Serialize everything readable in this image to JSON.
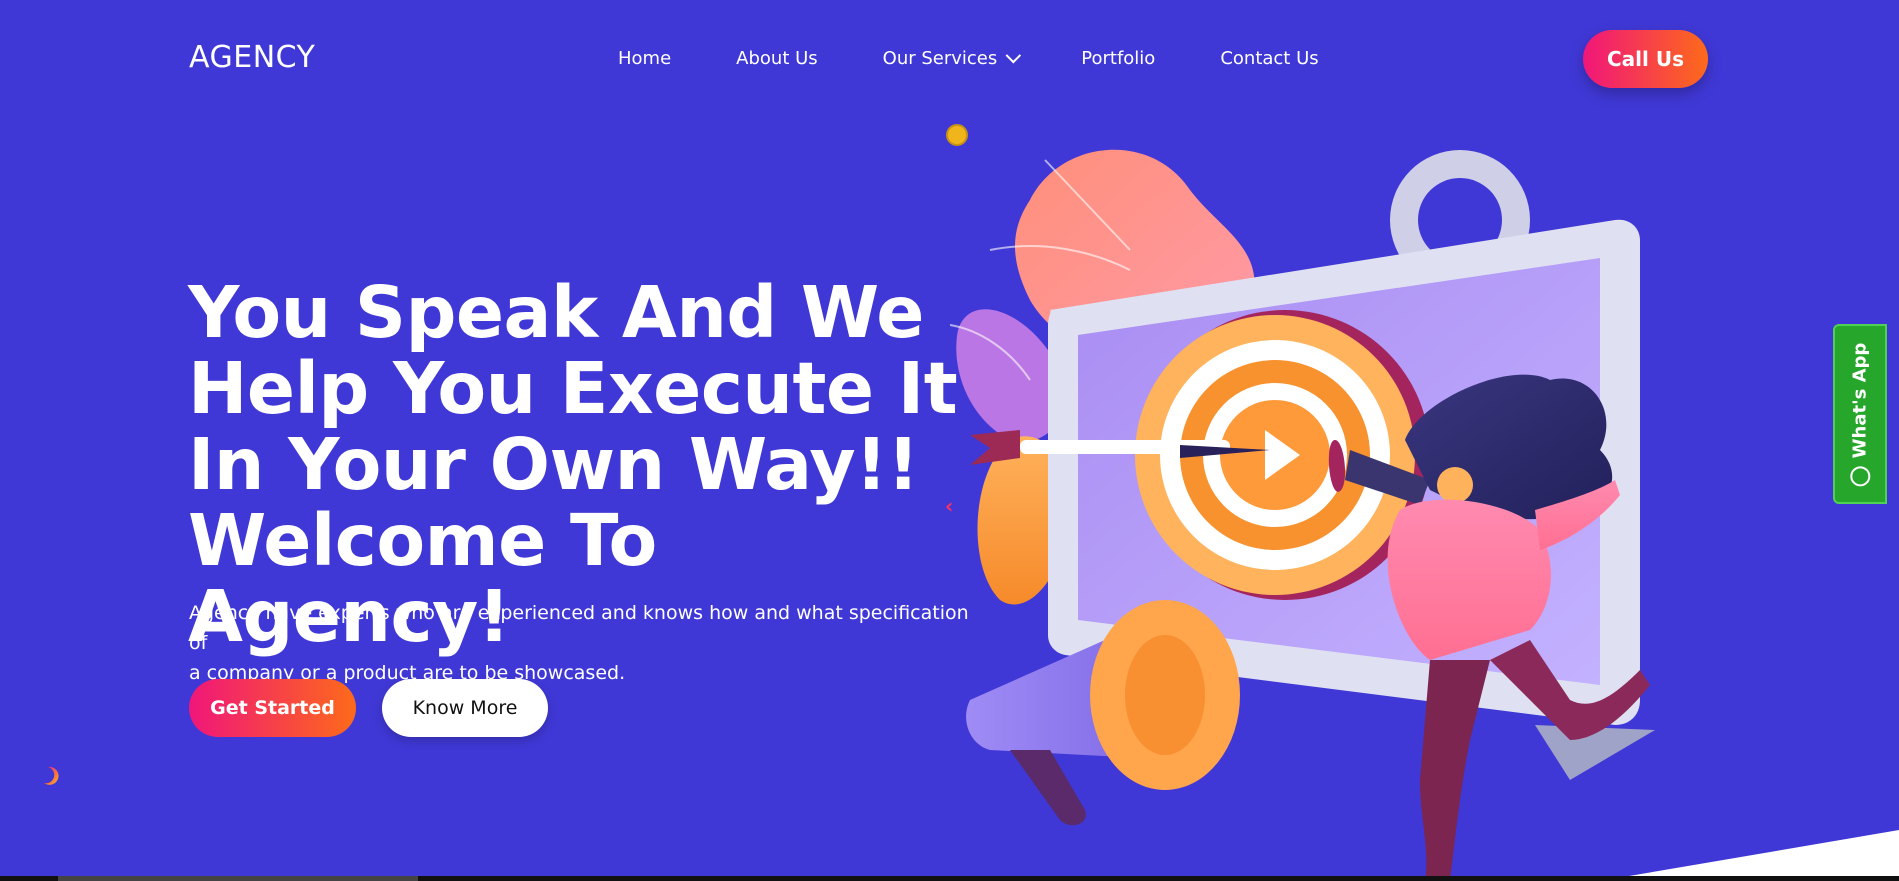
{
  "header": {
    "logo": "AGENCY",
    "nav": [
      {
        "label": "Home"
      },
      {
        "label": "About Us"
      },
      {
        "label": "Our Services",
        "has_dropdown": true
      },
      {
        "label": "Portfolio"
      },
      {
        "label": "Contact Us"
      }
    ],
    "cta_label": "Call Us"
  },
  "hero": {
    "headline_lines": [
      "You Speak And We",
      "Help You Execute It",
      "In Your Own Way!!",
      "Welcome To Agency!"
    ],
    "subtext_lines": [
      "Agency have experts who are experienced and knows how and what specification of",
      "a company or a product are to be showcased."
    ],
    "primary_button": "Get Started",
    "secondary_button": "Know More"
  },
  "whatsapp": {
    "label": "What's App",
    "icon": "whatsapp-icon"
  },
  "colors": {
    "background": "#4038d6",
    "accent_start": "#f0167a",
    "accent_end": "#fd6a1a",
    "whatsapp": "#26a62a"
  }
}
